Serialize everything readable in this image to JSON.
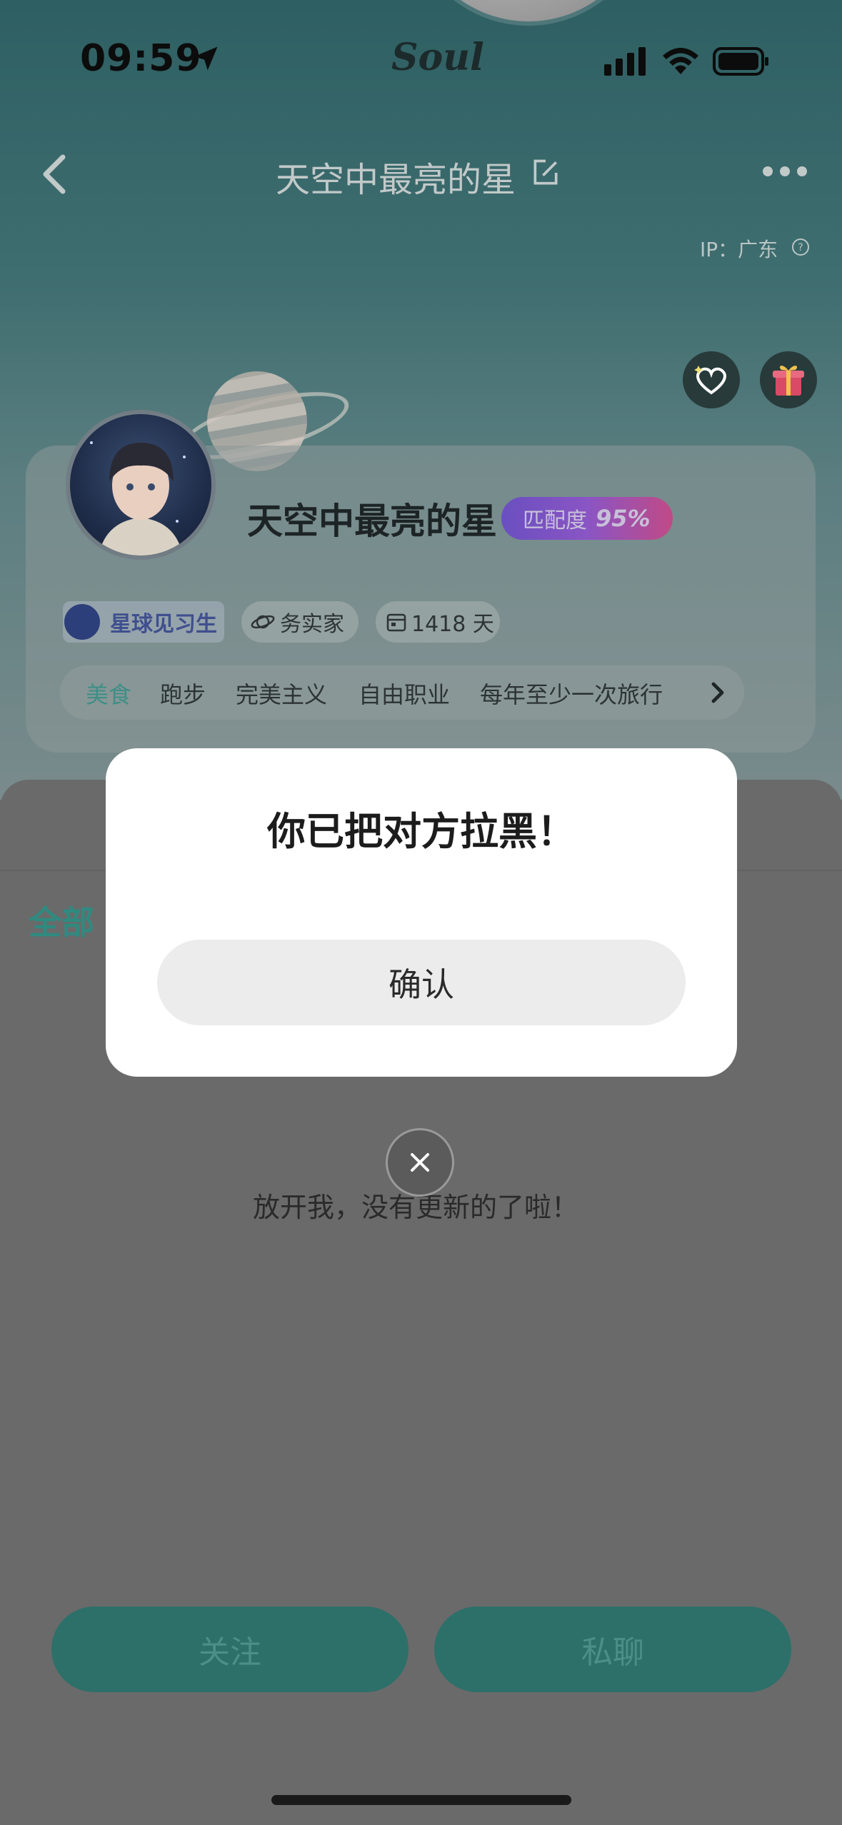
{
  "status_bar": {
    "time": "09:59",
    "brand": "Soul"
  },
  "nav": {
    "title": "天空中最亮的星",
    "ip_label": "IP：广东"
  },
  "profile": {
    "name": "天空中最亮的星",
    "match_label": "匹配度",
    "match_value": "95%",
    "badge": "星球见习生",
    "trait": "务实家",
    "days": "1418 天",
    "tags": [
      "美食",
      "跑步",
      "完美主义",
      "自由职业",
      "每年至少一次旅行"
    ]
  },
  "content": {
    "tab_all": "全部",
    "empty_text": "放开我，没有更新的了啦！"
  },
  "actions": {
    "follow": "关注",
    "chat": "私聊"
  },
  "dialog": {
    "title": "你已把对方拉黑！",
    "confirm": "确认"
  },
  "colors": {
    "accent": "#2c7069",
    "active_tag": "#3e8f86",
    "match_start": "#6a4fc0",
    "match_end": "#c04a86"
  }
}
